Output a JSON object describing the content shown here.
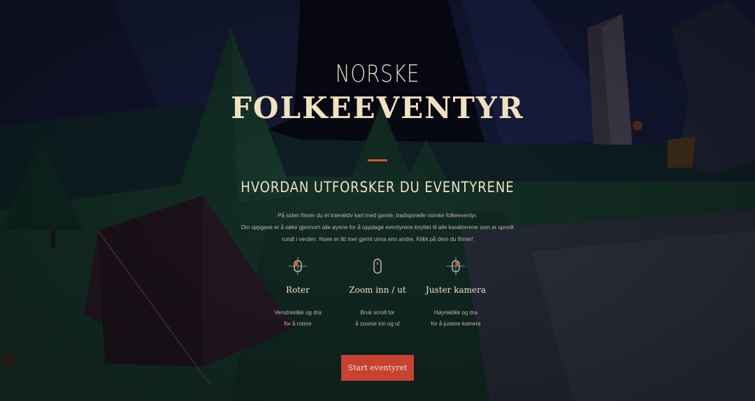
{
  "title": {
    "top": "NORSKE",
    "main": "FOLKEEVENTYR"
  },
  "section": {
    "heading": "HVORDAN UTFORSKER DU EVENTYRENE",
    "intro_lines": [
      "På siden finner du et interaktiv kart med gamle, tradisjonelle norske folkeeventyr.",
      "Din oppgave er å søke gjennom alle øyene for å oppdage eventyrene knyttet til alle karakterene som er spredt",
      "rundt i verden. Noen er litt mer gjemt unna enn andre. Klikk på dem du finner!"
    ]
  },
  "controls": [
    {
      "icon": "rotate-mouse-icon",
      "label": "Roter",
      "desc_lines": [
        "Venstreklikk og dra",
        "for å rotere"
      ]
    },
    {
      "icon": "scroll-mouse-icon",
      "label": "Zoom inn / ut",
      "desc_lines": [
        "Bruk scroll for",
        "å zoome inn og ut"
      ]
    },
    {
      "icon": "camera-mouse-icon",
      "label": "Juster kamera",
      "desc_lines": [
        "Høyreklikk og dra",
        "for å justere kamera"
      ]
    }
  ],
  "cta": {
    "label": "Start eventyret"
  },
  "colors": {
    "accent": "#c8432f",
    "title": "#f1e2bf",
    "background": "#0a0c1e"
  }
}
